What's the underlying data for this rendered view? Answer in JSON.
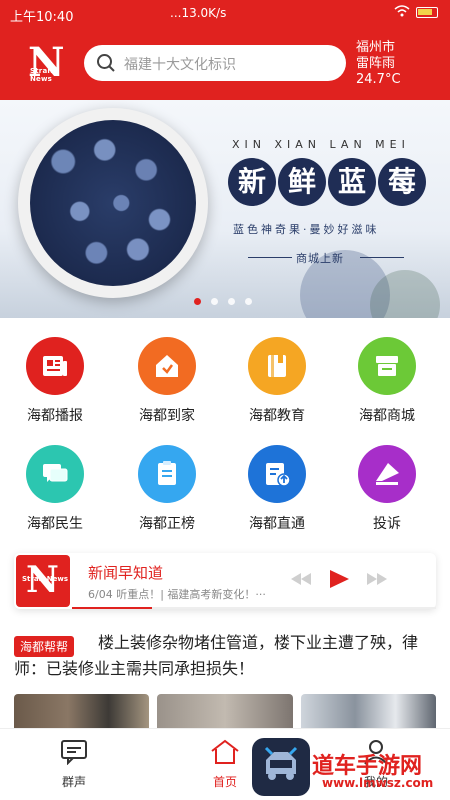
{
  "status": {
    "time": "上午10:40",
    "net_speed": "...13.0K/s",
    "battery_icon": "battery-icon"
  },
  "header": {
    "logo_big": "N",
    "logo_small": "Strait News",
    "search_placeholder": "福建十大文化标识",
    "weather_city": "福州市",
    "weather_condition": "雷阵雨",
    "weather_temp": "24.7°C",
    "brand_color": "#e0221f"
  },
  "banner": {
    "roman": "XIN XIAN LAN MEI",
    "title_chars": [
      "新",
      "鲜",
      "蓝",
      "莓"
    ],
    "subtitle": "蓝色神奇果·曼妙好滋味",
    "mall": "商城上新",
    "dots": 4,
    "active_dot": 0
  },
  "features": [
    {
      "label": "海都播报",
      "color": "#e0221f",
      "icon": "news-icon"
    },
    {
      "label": "海都到家",
      "color": "#f26b22",
      "icon": "home-icon"
    },
    {
      "label": "海都教育",
      "color": "#f5a623",
      "icon": "book-icon"
    },
    {
      "label": "海都商城",
      "color": "#6cc937",
      "icon": "store-icon"
    },
    {
      "label": "海都民生",
      "color": "#2cc6b0",
      "icon": "chat-icon"
    },
    {
      "label": "海都正榜",
      "color": "#35a7f0",
      "icon": "clipboard-icon"
    },
    {
      "label": "海都直通",
      "color": "#1e73d8",
      "icon": "upload-icon"
    },
    {
      "label": "投诉",
      "color": "#a72ec9",
      "icon": "complaint-icon"
    }
  ],
  "news_strip": {
    "title": "新闻早知道",
    "subtitle": "6/04 听重点！| 福建高考新变化！···",
    "progress": 0.22
  },
  "headline": {
    "tag": "海都帮帮",
    "text": "楼上装修杂物堵住管道，楼下业主遭了殃，律师：已装修业主需共同承担损失！"
  },
  "bottom_nav": {
    "left": "群声",
    "center": "首页",
    "right": "我的"
  },
  "watermark": {
    "line1": "道车手游网",
    "line2": "www.lmwsz.com"
  }
}
